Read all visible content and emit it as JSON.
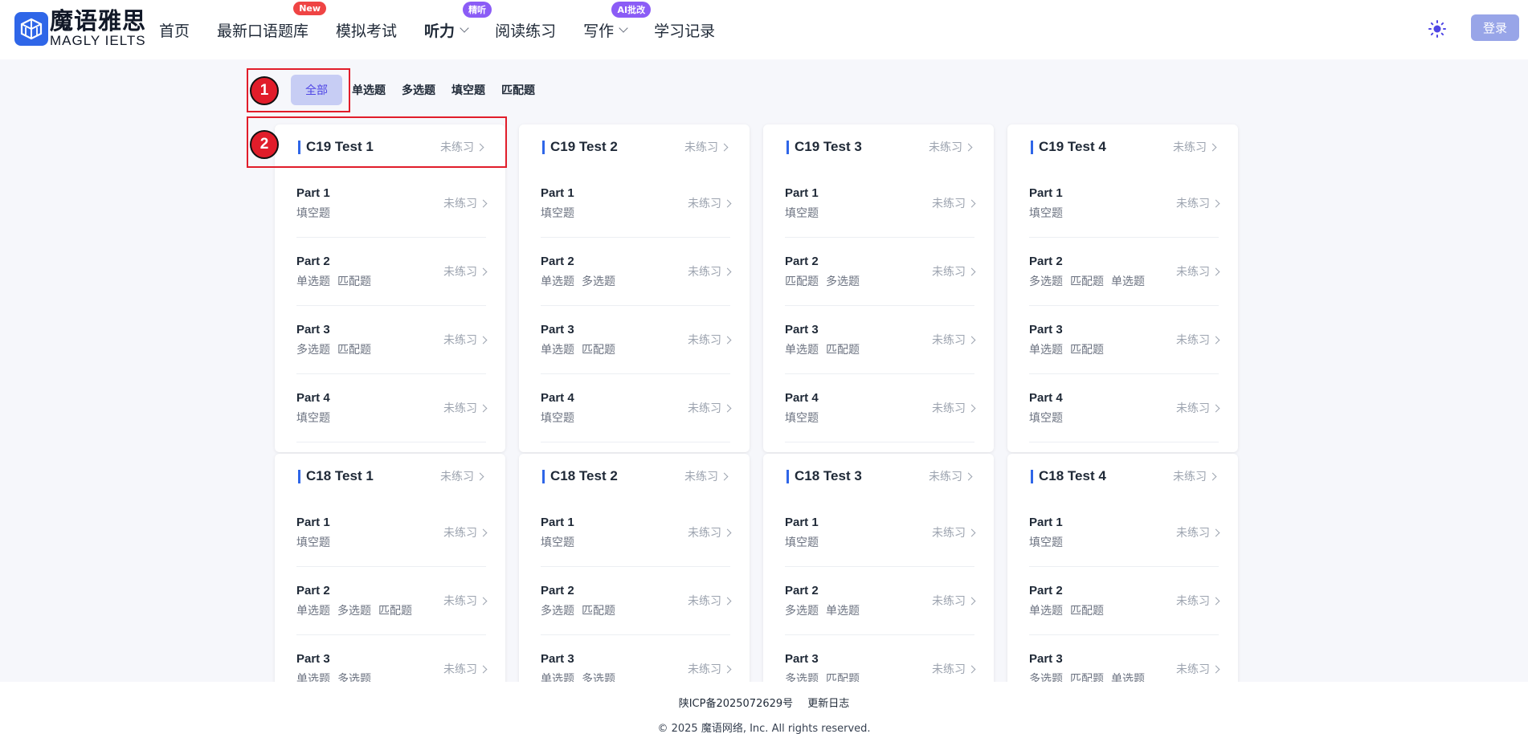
{
  "logo": {
    "cn": "魔语雅思",
    "en": "MAGLY IELTS"
  },
  "nav": [
    {
      "label": "首页",
      "bold": false
    },
    {
      "label": "最新口语题库",
      "bold": false,
      "badge": "New",
      "badge_color": "red"
    },
    {
      "label": "模拟考试",
      "bold": false
    },
    {
      "label": "听力",
      "bold": true,
      "dropdown": true,
      "badge": "精听",
      "badge_color": "purple"
    },
    {
      "label": "阅读练习",
      "bold": false
    },
    {
      "label": "写作",
      "bold": false,
      "dropdown": true,
      "badge": "AI批改",
      "badge_color": "purple2"
    },
    {
      "label": "学习记录",
      "bold": false
    }
  ],
  "header": {
    "login_label": "登录",
    "theme_icon": "sun-icon"
  },
  "filters": [
    "全部",
    "单选题",
    "多选题",
    "填空题",
    "匹配题"
  ],
  "annotations": [
    "1",
    "2"
  ],
  "cards": [
    {
      "title": "C19 Test 1",
      "status": "未练习",
      "parts": [
        {
          "name": "Part 1",
          "tags": [
            "填空题"
          ],
          "status": "未练习"
        },
        {
          "name": "Part 2",
          "tags": [
            "单选题",
            "匹配题"
          ],
          "status": "未练习"
        },
        {
          "name": "Part 3",
          "tags": [
            "多选题",
            "匹配题"
          ],
          "status": "未练习"
        },
        {
          "name": "Part 4",
          "tags": [
            "填空题"
          ],
          "status": "未练习"
        }
      ]
    },
    {
      "title": "C19 Test 2",
      "status": "未练习",
      "parts": [
        {
          "name": "Part 1",
          "tags": [
            "填空题"
          ],
          "status": "未练习"
        },
        {
          "name": "Part 2",
          "tags": [
            "单选题",
            "多选题"
          ],
          "status": "未练习"
        },
        {
          "name": "Part 3",
          "tags": [
            "单选题",
            "匹配题"
          ],
          "status": "未练习"
        },
        {
          "name": "Part 4",
          "tags": [
            "填空题"
          ],
          "status": "未练习"
        }
      ]
    },
    {
      "title": "C19 Test 3",
      "status": "未练习",
      "parts": [
        {
          "name": "Part 1",
          "tags": [
            "填空题"
          ],
          "status": "未练习"
        },
        {
          "name": "Part 2",
          "tags": [
            "匹配题",
            "多选题"
          ],
          "status": "未练习"
        },
        {
          "name": "Part 3",
          "tags": [
            "单选题",
            "匹配题"
          ],
          "status": "未练习"
        },
        {
          "name": "Part 4",
          "tags": [
            "填空题"
          ],
          "status": "未练习"
        }
      ]
    },
    {
      "title": "C19 Test 4",
      "status": "未练习",
      "parts": [
        {
          "name": "Part 1",
          "tags": [
            "填空题"
          ],
          "status": "未练习"
        },
        {
          "name": "Part 2",
          "tags": [
            "多选题",
            "匹配题",
            "单选题"
          ],
          "status": "未练习"
        },
        {
          "name": "Part 3",
          "tags": [
            "单选题",
            "匹配题"
          ],
          "status": "未练习"
        },
        {
          "name": "Part 4",
          "tags": [
            "填空题"
          ],
          "status": "未练习"
        }
      ]
    },
    {
      "title": "C18 Test 1",
      "status": "未练习",
      "parts": [
        {
          "name": "Part 1",
          "tags": [
            "填空题"
          ],
          "status": "未练习"
        },
        {
          "name": "Part 2",
          "tags": [
            "单选题",
            "多选题",
            "匹配题"
          ],
          "status": "未练习"
        },
        {
          "name": "Part 3",
          "tags": [
            "单选题",
            "多选题"
          ],
          "status": "未练习"
        }
      ]
    },
    {
      "title": "C18 Test 2",
      "status": "未练习",
      "parts": [
        {
          "name": "Part 1",
          "tags": [
            "填空题"
          ],
          "status": "未练习"
        },
        {
          "name": "Part 2",
          "tags": [
            "多选题",
            "匹配题"
          ],
          "status": "未练习"
        },
        {
          "name": "Part 3",
          "tags": [
            "单选题",
            "多选题"
          ],
          "status": "未练习"
        }
      ]
    },
    {
      "title": "C18 Test 3",
      "status": "未练习",
      "parts": [
        {
          "name": "Part 1",
          "tags": [
            "填空题"
          ],
          "status": "未练习"
        },
        {
          "name": "Part 2",
          "tags": [
            "多选题",
            "单选题"
          ],
          "status": "未练习"
        },
        {
          "name": "Part 3",
          "tags": [
            "多选题",
            "匹配题"
          ],
          "status": "未练习"
        }
      ]
    },
    {
      "title": "C18 Test 4",
      "status": "未练习",
      "parts": [
        {
          "name": "Part 1",
          "tags": [
            "填空题"
          ],
          "status": "未练习"
        },
        {
          "name": "Part 2",
          "tags": [
            "单选题",
            "匹配题"
          ],
          "status": "未练习"
        },
        {
          "name": "Part 3",
          "tags": [
            "多选题",
            "匹配题",
            "单选题"
          ],
          "status": "未练习"
        }
      ]
    }
  ],
  "footer": {
    "icp": "陕ICP备2025072629号",
    "changelog": "更新日志",
    "copyright": "© 2025 魔语网络, Inc. All rights reserved."
  }
}
